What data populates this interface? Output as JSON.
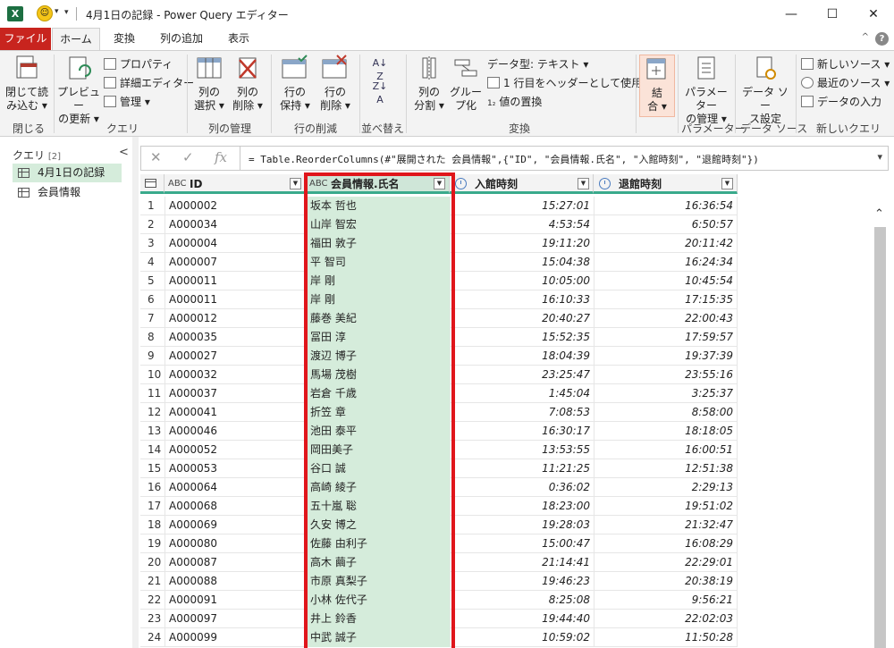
{
  "window": {
    "title": "4月1日の記録 - Power Query エディター",
    "app_icon": "X",
    "minimize": "—",
    "maximize": "☐",
    "close": "✕"
  },
  "tabs": [
    {
      "label": "ファイル"
    },
    {
      "label": "ホーム"
    },
    {
      "label": "変換"
    },
    {
      "label": "列の追加"
    },
    {
      "label": "表示"
    }
  ],
  "help": "?",
  "ribbon": {
    "close_load": "閉じて読\nみ込む ▾",
    "refresh_preview": "プレビュー\nの更新 ▾",
    "properties": "プロパティ",
    "advanced_editor": "詳細エディター",
    "manage": "管理 ▾",
    "choose_columns": "列の\n選択 ▾",
    "remove_columns": "列の\n削除 ▾",
    "keep_rows": "行の\n保持 ▾",
    "remove_rows": "行の\n削除 ▾",
    "split_column": "列の\n分割 ▾",
    "group_by": "グルー\nプ化",
    "data_type": "データ型: テキスト ▾",
    "first_row_header": "1 行目をヘッダーとして使用 ▾",
    "replace_values": "値の置換",
    "combine": "結\n合 ▾",
    "manage_params": "パラメーター\nの管理 ▾",
    "datasource_settings": "データ ソー\nス設定",
    "new_source": "新しいソース ▾",
    "recent_sources": "最近のソース ▾",
    "enter_data": "データの入力",
    "groups": {
      "close": "閉じる",
      "query": "クエリ",
      "manage_columns": "列の管理",
      "reduce_rows": "行の削減",
      "sort": "並べ替え",
      "transform": "変換",
      "combine": "",
      "parameters": "パラメーター",
      "data_source": "データ ソース",
      "new_query": "新しいクエリ"
    }
  },
  "queries_pane": {
    "header": "クエリ",
    "count": "[2]",
    "items": [
      {
        "label": "4月1日の記録",
        "selected": true
      },
      {
        "label": "会員情報",
        "selected": false
      }
    ]
  },
  "formula": {
    "cancel": "✕",
    "confirm": "✓",
    "fx": "fx",
    "text": "= Table.ReorderColumns(#\"展開された 会員情報\",{\"ID\", \"会員情報.氏名\", \"入館時刻\", \"退館時刻\"})"
  },
  "columns": [
    {
      "type": "ABC",
      "name": "ID"
    },
    {
      "type": "ABC",
      "name": "会員情報.氏名"
    },
    {
      "type": "time",
      "name": "入館時刻"
    },
    {
      "type": "time",
      "name": "退館時刻"
    }
  ],
  "rows": [
    [
      "1",
      "A000002",
      "坂本 哲也",
      "15:27:01",
      "16:36:54"
    ],
    [
      "2",
      "A000034",
      "山岸 智宏",
      "4:53:54",
      "6:50:57"
    ],
    [
      "3",
      "A000004",
      "福田 敦子",
      "19:11:20",
      "20:11:42"
    ],
    [
      "4",
      "A000007",
      "平 智司",
      "15:04:38",
      "16:24:34"
    ],
    [
      "5",
      "A000011",
      "岸 剛",
      "10:05:00",
      "10:45:54"
    ],
    [
      "6",
      "A000011",
      "岸 剛",
      "16:10:33",
      "17:15:35"
    ],
    [
      "7",
      "A000012",
      "藤巻 美紀",
      "20:40:27",
      "22:00:43"
    ],
    [
      "8",
      "A000035",
      "冨田 淳",
      "15:52:35",
      "17:59:57"
    ],
    [
      "9",
      "A000027",
      "渡辺 博子",
      "18:04:39",
      "19:37:39"
    ],
    [
      "10",
      "A000032",
      "馬場 茂樹",
      "23:25:47",
      "23:55:16"
    ],
    [
      "11",
      "A000037",
      "岩倉 千歳",
      "1:45:04",
      "3:25:37"
    ],
    [
      "12",
      "A000041",
      "折笠 章",
      "7:08:53",
      "8:58:00"
    ],
    [
      "13",
      "A000046",
      "池田 泰平",
      "16:30:17",
      "18:18:05"
    ],
    [
      "14",
      "A000052",
      "岡田美子",
      "13:53:55",
      "16:00:51"
    ],
    [
      "15",
      "A000053",
      "谷口 誠",
      "11:21:25",
      "12:51:38"
    ],
    [
      "16",
      "A000064",
      "高崎 綾子",
      "0:36:02",
      "2:29:13"
    ],
    [
      "17",
      "A000068",
      "五十嵐 聡",
      "18:23:00",
      "19:51:02"
    ],
    [
      "18",
      "A000069",
      "久安 博之",
      "19:28:03",
      "21:32:47"
    ],
    [
      "19",
      "A000080",
      "佐藤 由利子",
      "15:00:47",
      "16:08:29"
    ],
    [
      "20",
      "A000087",
      "高木 繭子",
      "21:14:41",
      "22:29:01"
    ],
    [
      "21",
      "A000088",
      "市原 真梨子",
      "19:46:23",
      "20:38:19"
    ],
    [
      "22",
      "A000091",
      "小林 佐代子",
      "8:25:08",
      "9:56:21"
    ],
    [
      "23",
      "A000097",
      "井上 鈴香",
      "19:44:40",
      "22:02:03"
    ],
    [
      "24",
      "A000099",
      "中武 誠子",
      "10:59:02",
      "11:50:28"
    ]
  ],
  "colors": {
    "file_tab": "#c8241e",
    "selected_column": "#d5ecdb",
    "highlight_box": "#e0161b",
    "header_underline": "#3aaa8c"
  }
}
